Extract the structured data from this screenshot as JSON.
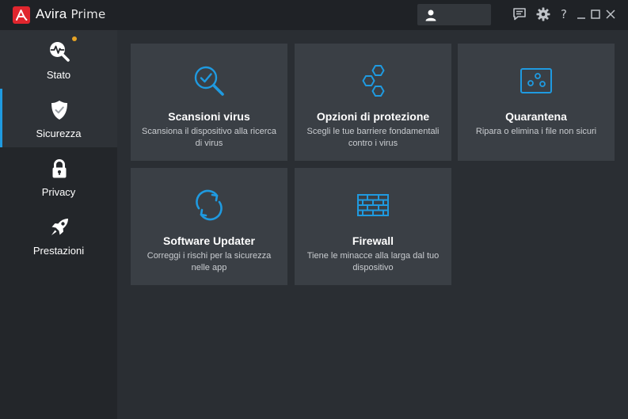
{
  "app": {
    "brand": "Avira",
    "edition": "Prime"
  },
  "sidebar": {
    "items": [
      {
        "label": "Stato",
        "icon": "activity-scan-icon"
      },
      {
        "label": "Sicurezza",
        "icon": "shield-icon"
      },
      {
        "label": "Privacy",
        "icon": "lock-icon"
      },
      {
        "label": "Prestazioni",
        "icon": "rocket-icon"
      }
    ],
    "active": "Sicurezza"
  },
  "cards": [
    {
      "title": "Scansioni virus",
      "description": "Scansiona il dispositivo alla ricerca di virus",
      "icon": "magnifier-check-icon"
    },
    {
      "title": "Opzioni di protezione",
      "description": "Scegli le tue barriere fondamentali contro i virus",
      "icon": "hexagons-icon"
    },
    {
      "title": "Quarantena",
      "description": "Ripara o elimina i file non sicuri",
      "icon": "quarantine-box-icon"
    },
    {
      "title": "Software Updater",
      "description": "Correggi i rischi per la sicurezza nelle app",
      "icon": "refresh-arrows-icon"
    },
    {
      "title": "Firewall",
      "description": "Tiene le minacce alla larga dal tuo dispositivo",
      "icon": "brick-wall-icon"
    }
  ],
  "titlebar": {
    "help_label": "?"
  },
  "colors": {
    "accent": "#1f9ae0",
    "brand": "#e0262e",
    "notification": "#e6a325",
    "card": "#3a3f45",
    "background": "#2a2e33"
  }
}
